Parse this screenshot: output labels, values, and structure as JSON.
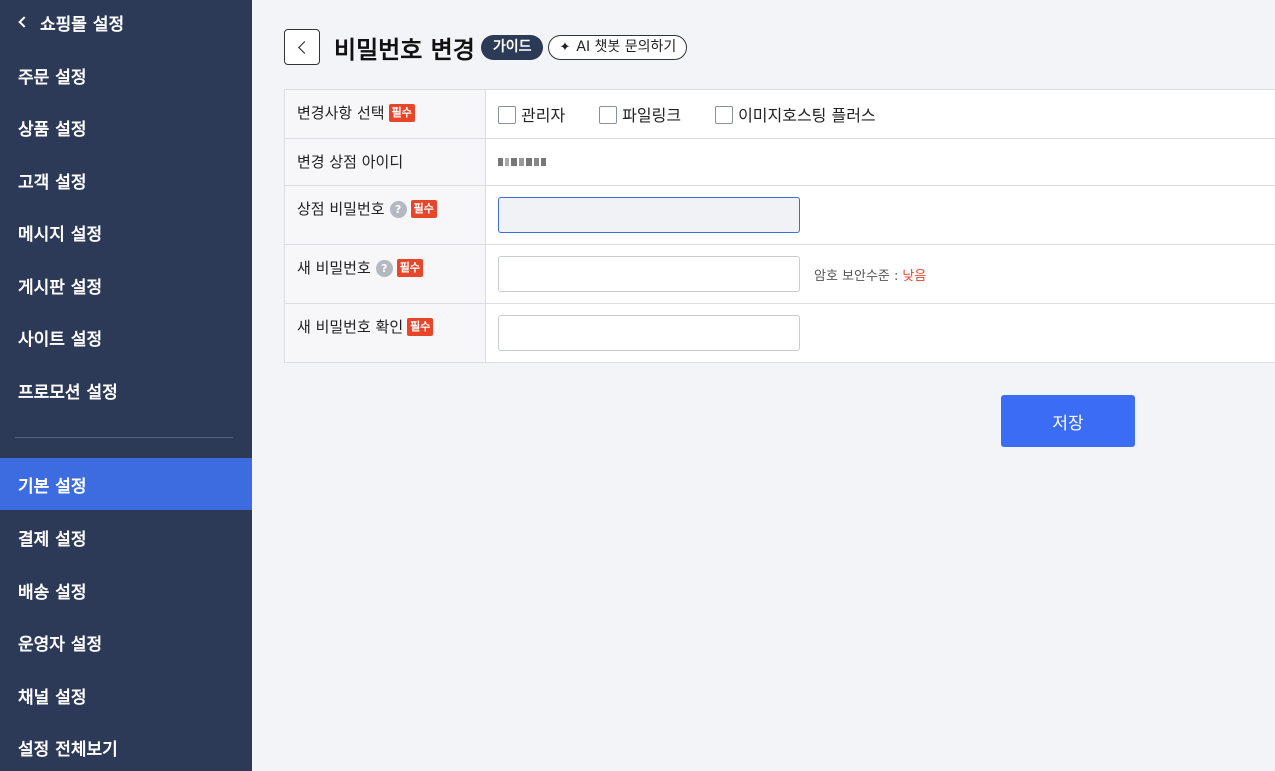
{
  "sidebar": {
    "header": "쇼핑몰 설정",
    "items": [
      {
        "label": "주문 설정"
      },
      {
        "label": "상품 설정"
      },
      {
        "label": "고객 설정"
      },
      {
        "label": "메시지 설정"
      },
      {
        "label": "게시판 설정"
      },
      {
        "label": "사이트 설정"
      },
      {
        "label": "프로모션 설정"
      }
    ],
    "items2": [
      {
        "label": "기본 설정",
        "active": true
      },
      {
        "label": "결제 설정"
      },
      {
        "label": "배송 설정"
      },
      {
        "label": "운영자 설정"
      },
      {
        "label": "채널 설정"
      },
      {
        "label": "설정 전체보기"
      }
    ]
  },
  "header": {
    "title": "비밀번호 변경",
    "guide": "가이드",
    "ai_button": "AI 챗봇 문의하기"
  },
  "form": {
    "required_badge": "필수",
    "help_mark": "?",
    "change_target": {
      "label": "변경사항 선택",
      "options": [
        "관리자",
        "파일링크",
        "이미지호스팅 플러스"
      ]
    },
    "shop_id": {
      "label": "변경 상점 아이디"
    },
    "shop_password": {
      "label": "상점 비밀번호",
      "value": ""
    },
    "new_password": {
      "label": "새 비밀번호",
      "value": "",
      "strength_label": "암호 보안수준 :",
      "strength_value": "낮음"
    },
    "confirm_password": {
      "label": "새 비밀번호 확인",
      "value": ""
    }
  },
  "actions": {
    "save": "저장"
  },
  "colors": {
    "sidebar_bg": "#2c3a58",
    "sidebar_active": "#3d6ce0",
    "primary_button": "#3a6cf4",
    "required_badge": "#e8462b"
  }
}
